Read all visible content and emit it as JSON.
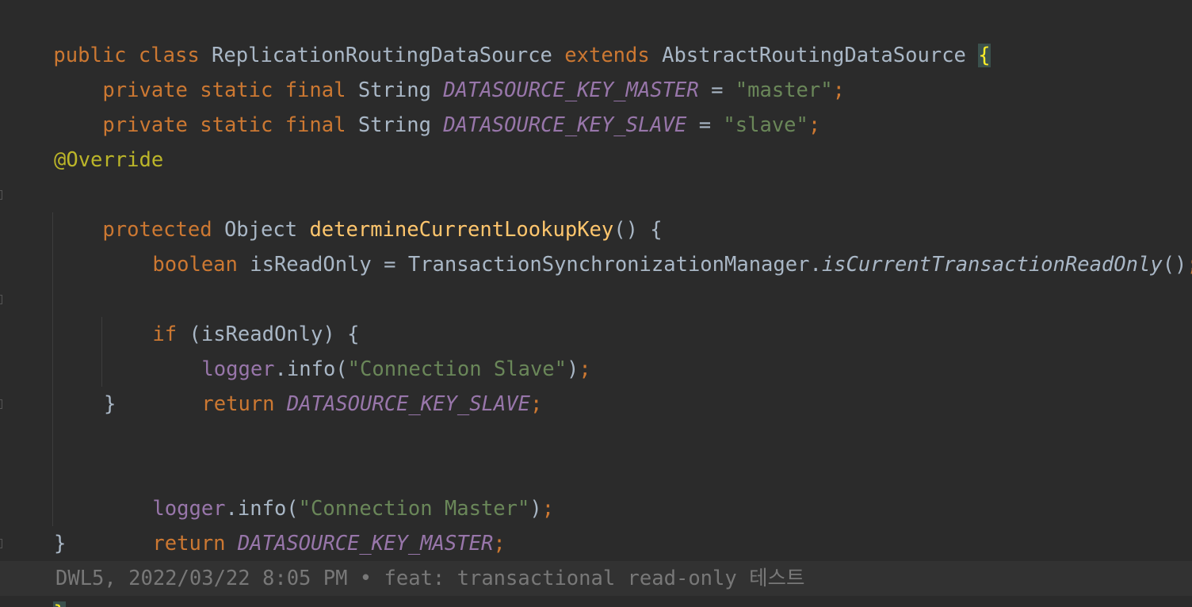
{
  "code": {
    "class_line": {
      "public": "public",
      "class": "class",
      "name": "ReplicationRoutingDataSource",
      "extends": "extends",
      "parent": "AbstractRoutingDataSource",
      "brace": "{"
    },
    "field_master": {
      "modifiers": "private static final",
      "type": "String",
      "name": "DATASOURCE_KEY_MASTER",
      "eq": " = ",
      "value": "\"master\"",
      "semi": ";"
    },
    "field_slave": {
      "modifiers": "private static final",
      "type": "String",
      "name": "DATASOURCE_KEY_SLAVE",
      "eq": " = ",
      "value": "\"slave\"",
      "semi": ";"
    },
    "annotation": "@Override",
    "method_decl": {
      "modifier": "protected",
      "return_type": "Object",
      "name": "determineCurrentLookupKey",
      "rest": "() {"
    },
    "readonly_line": {
      "type": "boolean",
      "var": "isReadOnly",
      "eq": " = ",
      "receiver": "TransactionSynchronizationManager.",
      "call": "isCurrentTransactionReadOnly",
      "parens": "()",
      "semi": ";"
    },
    "if_line": {
      "kw": "if",
      "rest": " (isReadOnly) {"
    },
    "log_slave": {
      "logger": "logger",
      "call": ".info(",
      "msg": "\"Connection Slave\"",
      "close": ")",
      "semi": ";"
    },
    "return_slave": {
      "kw": "return",
      "value": "DATASOURCE_KEY_SLAVE",
      "semi": ";"
    },
    "if_close": "}",
    "log_master": {
      "logger": "logger",
      "call": ".info(",
      "msg": "\"Connection Master\"",
      "close": ")",
      "semi": ";"
    },
    "return_master": {
      "kw": "return",
      "value": "DATASOURCE_KEY_MASTER",
      "semi": ";"
    },
    "method_close": "}",
    "class_close": "}"
  },
  "blame": {
    "text": "DWL5, 2022/03/22 8:05 PM • feat: transactional read-only 테스트"
  },
  "colors": {
    "background": "#2b2b2b",
    "keyword": "#cc7832",
    "string": "#6a8759",
    "constant": "#9876aa",
    "annotation": "#bbb529",
    "method_declaration": "#ffc66d",
    "plain": "#a9b7c6",
    "blame": "#787878"
  }
}
